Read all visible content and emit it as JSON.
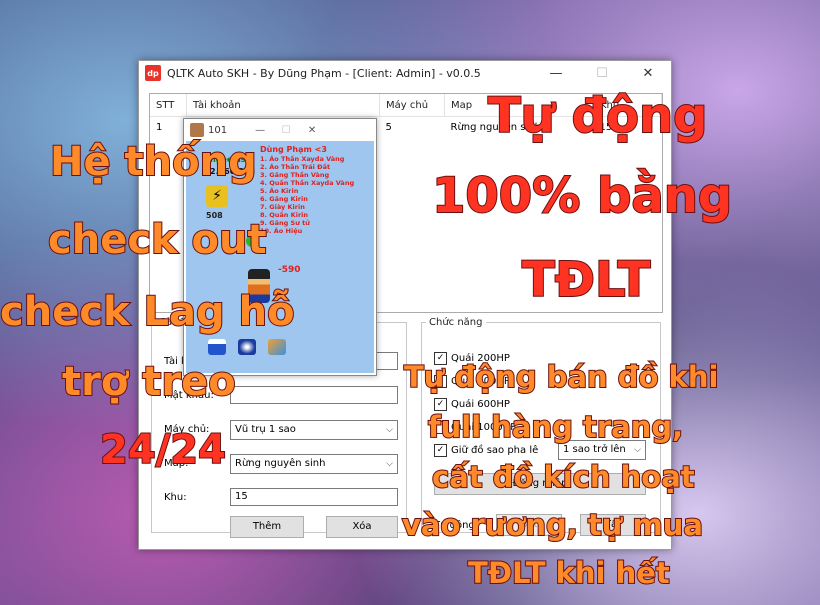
{
  "window": {
    "title": "QLTK Auto SKH - By Dũng Phạm - [Client: Admin] - v0.0.5",
    "icon_text": "dp"
  },
  "grid": {
    "columns": [
      "STT",
      "Tài khoản",
      "Máy chủ",
      "Map",
      "Khu"
    ],
    "rows": [
      {
        "stt": "1",
        "account": "",
        "server": "5",
        "map": "Rừng nguyên sinh",
        "zone": "15"
      }
    ]
  },
  "left_group": {
    "legend": "Cài đặt",
    "account_label": "Tài khoản:",
    "password_label": "Mật khẩu:",
    "server_label": "Máy chủ:",
    "server_value": "Vũ trụ 1 sao",
    "map_label": "Map:",
    "map_value": "Rừng nguyên sinh",
    "zone_label": "Khu:",
    "zone_value": "15",
    "add_button": "Thêm",
    "delete_button": "Xóa"
  },
  "right_group": {
    "legend": "Chức năng",
    "checks": [
      {
        "label": "Quái 200HP",
        "checked": true
      },
      {
        "label": "Quái 500HP",
        "checked": true
      },
      {
        "label": "Quái 600HP",
        "checked": true
      },
      {
        "label": "Quái 1000HP",
        "checked": false
      },
      {
        "label": "Giữ đồ sao pha lê",
        "checked": true
      }
    ],
    "star_select": "1 sao trở lên",
    "login_button": "Đăng nhập",
    "auto_label": "Tự động:",
    "on_button": "Bật",
    "off_button": "Tắt"
  },
  "popup": {
    "title": "101",
    "left_name": "kingeeldss",
    "left_stat": "2.560.288",
    "power": "508",
    "hp_badge": "-590",
    "right_name": "Dùng Phạm <3",
    "items": [
      "1. Áo Thần Xayda Vàng",
      "2. Áo Thần Trái Đất",
      "3. Găng Thần Vàng",
      "4. Quần Thần Xayda Vàng",
      "5. Áo Kirin",
      "6. Găng Kirin",
      "7. Giày Kirin",
      "8. Quần Kirin",
      "9. Găng Sư tử",
      "10. Áo Hiệu"
    ]
  },
  "overlays": {
    "top_right": [
      "Tự động",
      "100% bằng",
      "TĐLT"
    ],
    "left": [
      "Hệ thống",
      "check out",
      "check Lag hỗ",
      "trợ treo",
      "24/24"
    ],
    "bottom_right": [
      "Tự động bán đồ khi",
      "full hàng trang,",
      "cất đồ kích hoạt",
      "vào rương, tự mua",
      "TĐLT khi hết"
    ]
  }
}
